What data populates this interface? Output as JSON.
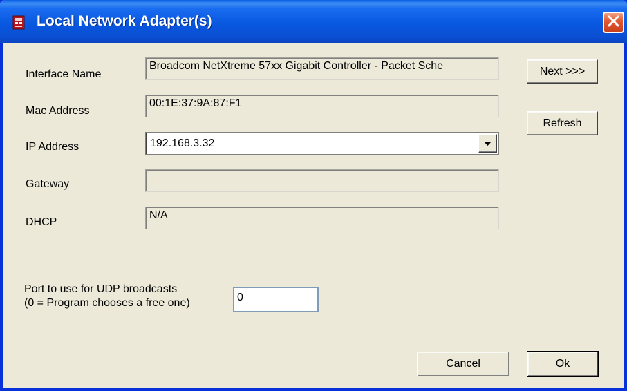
{
  "window": {
    "title": "Local Network Adapter(s)"
  },
  "fields": {
    "interface_name": {
      "label": "Interface Name",
      "value": "Broadcom NetXtreme 57xx Gigabit Controller - Packet Sche"
    },
    "mac_address": {
      "label": "Mac Address",
      "value": "00:1E:37:9A:87:F1"
    },
    "ip_address": {
      "label": "IP Address",
      "value": "192.168.3.32"
    },
    "gateway": {
      "label": "Gateway",
      "value": ""
    },
    "dhcp": {
      "label": "DHCP",
      "value": "N/A"
    },
    "udp_port": {
      "label_line1": "Port to use for UDP broadcasts",
      "label_line2": "(0 = Program chooses a free one)",
      "value": "0"
    }
  },
  "buttons": {
    "next": "Next >>>",
    "refresh": "Refresh",
    "cancel": "Cancel",
    "ok": "Ok"
  },
  "icons": {
    "app": "network-adapter-icon",
    "close": "close-icon",
    "dropdown": "chevron-down-icon"
  },
  "colors": {
    "titlebar": "#0a58e0",
    "close_button": "#e25a34",
    "dialog_background": "#ece9d8"
  }
}
